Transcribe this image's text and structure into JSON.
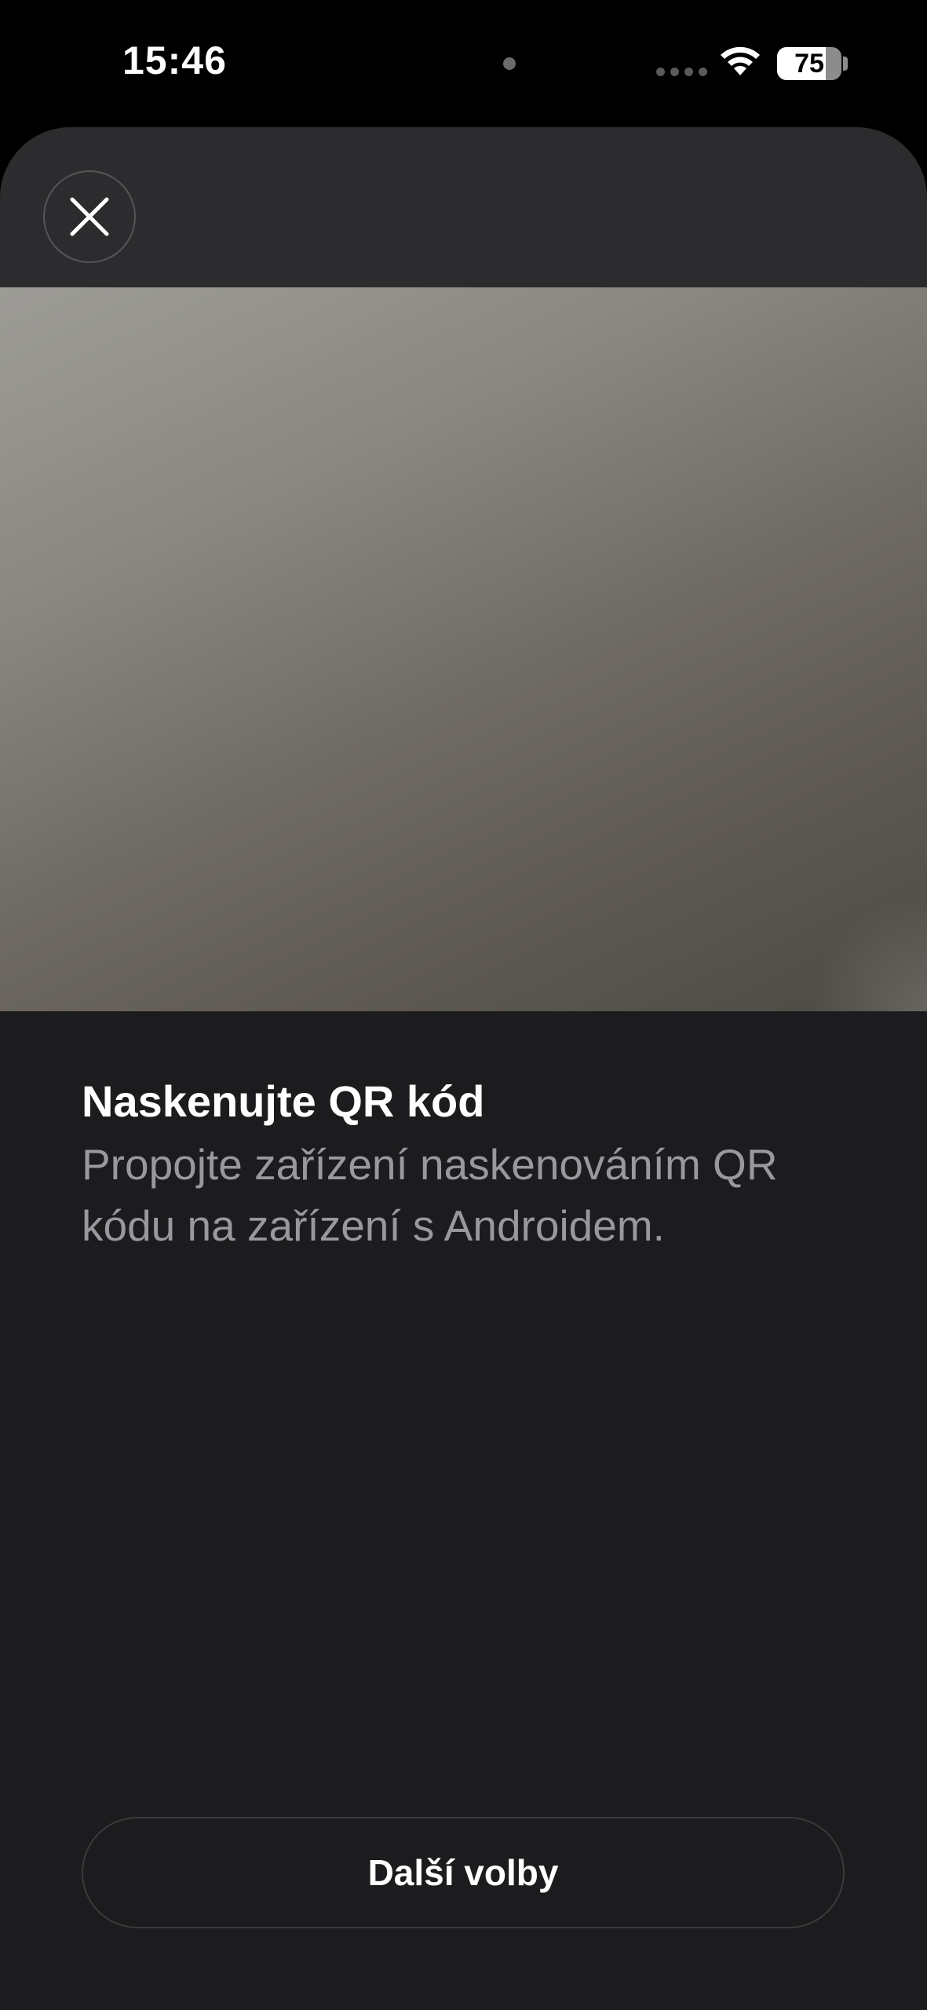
{
  "status_bar": {
    "time": "15:46",
    "battery_level": "75",
    "battery_fraction": 0.75
  },
  "sheet": {
    "close_icon": "close-icon",
    "title": "Naskenujte QR kód",
    "description": "Propojte zařízení naskenováním QR kódu na zařízení s Androidem.",
    "more_options_label": "Další volby"
  },
  "colors": {
    "background": "#000000",
    "sheet_background": "#1c1c1e",
    "header_background": "#2c2c2e",
    "title_text": "#ffffff",
    "secondary_text": "#98989d"
  }
}
